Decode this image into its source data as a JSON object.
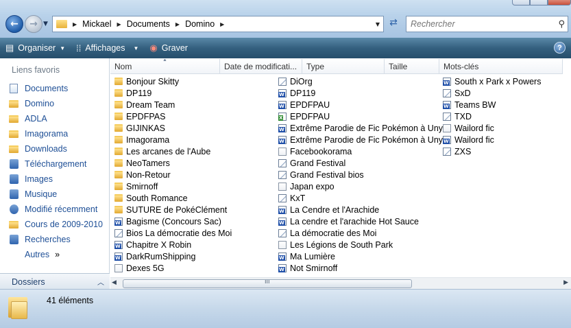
{
  "address": {
    "crumbs": [
      "Mickael",
      "Documents",
      "Domino"
    ],
    "search_placeholder": "Rechercher"
  },
  "toolbar": {
    "organize_label": "Organiser",
    "views_label": "Affichages",
    "burn_label": "Graver",
    "help_label": "?"
  },
  "sidebar": {
    "title": "Liens favoris",
    "items": [
      {
        "label": "Documents",
        "icon": "documents-icon"
      },
      {
        "label": "Domino",
        "icon": "folder-icon"
      },
      {
        "label": "ADLA",
        "icon": "folder-icon"
      },
      {
        "label": "Imagorama",
        "icon": "folder-icon"
      },
      {
        "label": "Downloads",
        "icon": "folder-icon"
      },
      {
        "label": "Téléchargement",
        "icon": "documents-icon"
      },
      {
        "label": "Images",
        "icon": "pictures-icon"
      },
      {
        "label": "Musique",
        "icon": "music-icon"
      },
      {
        "label": "Modifié récemment",
        "icon": "recent-icon"
      },
      {
        "label": "Cours de 2009-2010",
        "icon": "folder-icon"
      },
      {
        "label": "Recherches",
        "icon": "search-folder-icon"
      }
    ],
    "more_label": "Autres",
    "more_arrow": "»",
    "folders_label": "Dossiers"
  },
  "columns": [
    "Nom",
    "Date de modificati...",
    "Type",
    "Taille",
    "Mots-clés"
  ],
  "files": {
    "col1": [
      {
        "name": "Bonjour Skitty",
        "type": "folder"
      },
      {
        "name": "DP119",
        "type": "folder"
      },
      {
        "name": "Dream Team",
        "type": "folder"
      },
      {
        "name": "EPDFPAS",
        "type": "folder"
      },
      {
        "name": "GIJINKAS",
        "type": "folder"
      },
      {
        "name": "Imagorama",
        "type": "folder"
      },
      {
        "name": "Les arcanes de l'Aube",
        "type": "folder"
      },
      {
        "name": "NeoTamers",
        "type": "folder"
      },
      {
        "name": "Non-Retour",
        "type": "folder"
      },
      {
        "name": "Smirnoff",
        "type": "folder"
      },
      {
        "name": "South Romance",
        "type": "folder"
      },
      {
        "name": "SUTURE de PokéClément",
        "type": "folder"
      },
      {
        "name": "Bagisme (Concours Sac)",
        "type": "word"
      },
      {
        "name": "Bios La démocratie des Moi",
        "type": "wri"
      },
      {
        "name": "Chapitre X Robin",
        "type": "word"
      },
      {
        "name": "DarkRumShipping",
        "type": "word"
      },
      {
        "name": "Dexes 5G",
        "type": "txt"
      }
    ],
    "col2": [
      {
        "name": "DiOrg",
        "type": "wri"
      },
      {
        "name": "DP119",
        "type": "word"
      },
      {
        "name": "EPDFPAU",
        "type": "word"
      },
      {
        "name": "EPDFPAU",
        "type": "excel"
      },
      {
        "name": "Extrême Parodie de Fic Pokémon à Unys",
        "type": "word"
      },
      {
        "name": "Extrême Parodie de Fic Pokémon à Unys",
        "type": "word"
      },
      {
        "name": "Facebookorama",
        "type": "txt"
      },
      {
        "name": "Grand Festival",
        "type": "wri"
      },
      {
        "name": "Grand Festival bios",
        "type": "wri"
      },
      {
        "name": "Japan expo",
        "type": "txt"
      },
      {
        "name": "KxT",
        "type": "wri"
      },
      {
        "name": "La Cendre et l'Arachide",
        "type": "word"
      },
      {
        "name": "La cendre et l'arachide Hot Sauce",
        "type": "word"
      },
      {
        "name": "La démocratie des Moi",
        "type": "wri"
      },
      {
        "name": "Les Légions de South Park",
        "type": "txt"
      },
      {
        "name": "Ma Lumière",
        "type": "word"
      },
      {
        "name": "Not Smirnoff",
        "type": "word"
      }
    ],
    "col3": [
      {
        "name": "South x Park x Powers",
        "type": "word"
      },
      {
        "name": "SxD",
        "type": "wri"
      },
      {
        "name": "Teams BW",
        "type": "word"
      },
      {
        "name": "TXD",
        "type": "wri"
      },
      {
        "name": "Wailord fic",
        "type": "txt"
      },
      {
        "name": "Wailord fic",
        "type": "word"
      },
      {
        "name": "ZXS",
        "type": "wri"
      }
    ]
  },
  "status": {
    "count_text": "41 éléments"
  }
}
